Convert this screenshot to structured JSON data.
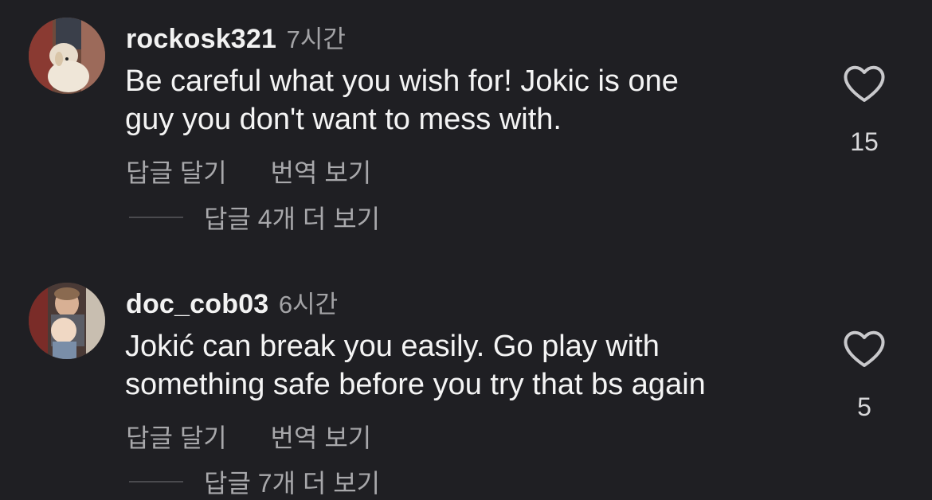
{
  "colors": {
    "background": "#1f1f23",
    "secondary_text": "#a8a8ab",
    "primary_text": "#f2f2f2"
  },
  "comments": [
    {
      "username": "rockosk321",
      "time": "7시간",
      "text_line1": "Be careful what you wish for!  Jokic is one",
      "text_line2": "guy you don't want to mess with.",
      "reply_label": "답글 달기",
      "translate_label": "번역 보기",
      "view_replies_label": "답글 4개 더 보기",
      "like_count": "15",
      "avatar_icon": "dog-photo-avatar",
      "like_icon": "heart-outline-icon"
    },
    {
      "username": "doc_cob03",
      "time": "6시간",
      "text_line1": "Jokić can break you easily. Go play with",
      "text_line2": "something safe before you try that bs again",
      "reply_label": "답글 달기",
      "translate_label": "번역 보기",
      "view_replies_label": "답글 7개 더 보기",
      "like_count": "5",
      "avatar_icon": "kids-photo-avatar",
      "like_icon": "heart-outline-icon"
    }
  ]
}
